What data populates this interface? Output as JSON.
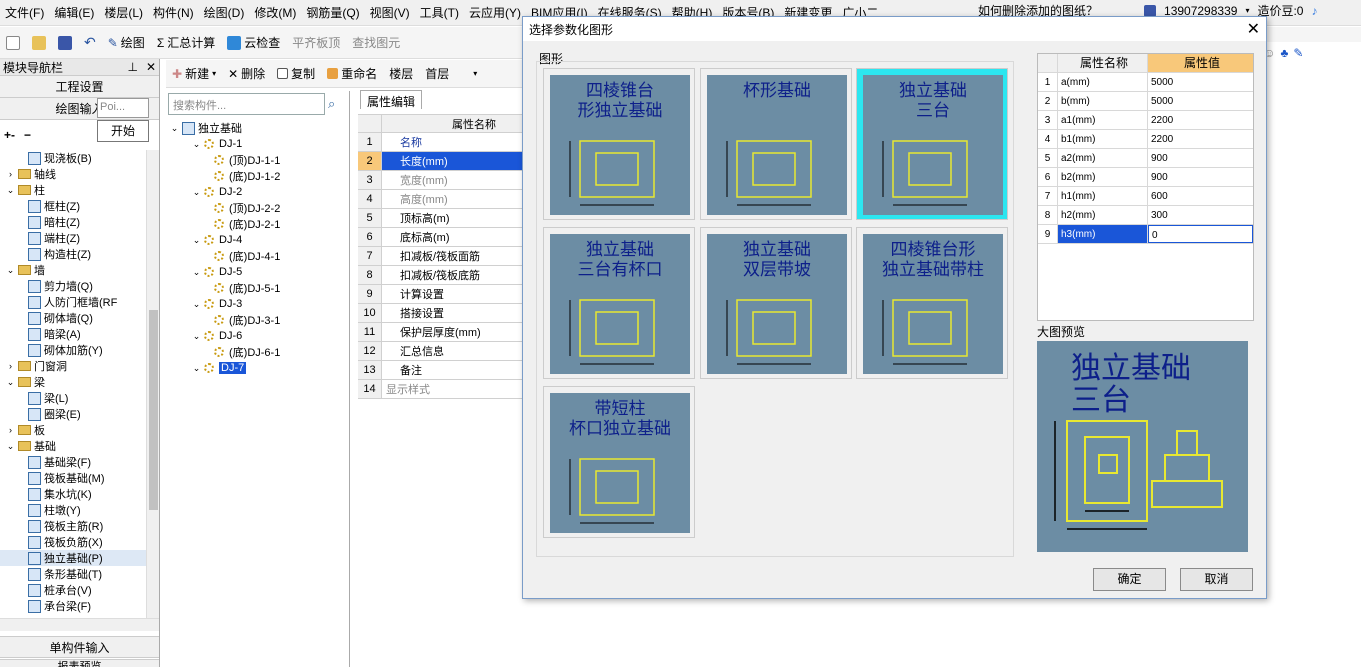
{
  "menu": [
    "文件(F)",
    "编辑(E)",
    "楼层(L)",
    "构件(N)",
    "绘图(D)",
    "修改(M)",
    "钢筋量(Q)",
    "视图(V)",
    "工具(T)",
    "云应用(Y)",
    "BIM应用(I)",
    "在线服务(S)",
    "帮助(H)",
    "版本号(B)",
    "新建变更",
    "广小二"
  ],
  "topright": {
    "help_text": "如何删除添加的图纸？",
    "phone": "13907298339",
    "coins": "造价豆:0"
  },
  "toolbar": {
    "draw": "绘图",
    "sum": "汇总计算",
    "cloud": "云检查",
    "flat": "平齐板顶",
    "find": "查找图元"
  },
  "subtoolbar": {
    "new": "新建",
    "delete": "删除",
    "copy": "复制",
    "rename": "重命名",
    "floor_label": "楼层",
    "floor_value": "首层"
  },
  "leftpanel": {
    "title": "模块导航栏",
    "project_btn": "工程设置",
    "draw_btn": "绘图输入",
    "popup_text": "Poi...",
    "start_btn": "开始",
    "items": [
      {
        "label": "现浇板(B)",
        "level": 2,
        "type": "leaf"
      },
      {
        "label": "轴线",
        "level": 1,
        "type": "folder",
        "fold": "+"
      },
      {
        "label": "柱",
        "level": 1,
        "type": "folder",
        "fold": "-"
      },
      {
        "label": "框柱(Z)",
        "level": 2,
        "type": "leaf"
      },
      {
        "label": "暗柱(Z)",
        "level": 2,
        "type": "leaf"
      },
      {
        "label": "端柱(Z)",
        "level": 2,
        "type": "leaf"
      },
      {
        "label": "构造柱(Z)",
        "level": 2,
        "type": "leaf"
      },
      {
        "label": "墙",
        "level": 1,
        "type": "folder",
        "fold": "-"
      },
      {
        "label": "剪力墙(Q)",
        "level": 2,
        "type": "leaf"
      },
      {
        "label": "人防门框墙(RF",
        "level": 2,
        "type": "leaf"
      },
      {
        "label": "砌体墙(Q)",
        "level": 2,
        "type": "leaf"
      },
      {
        "label": "暗梁(A)",
        "level": 2,
        "type": "leaf"
      },
      {
        "label": "砌体加筋(Y)",
        "level": 2,
        "type": "leaf"
      },
      {
        "label": "门窗洞",
        "level": 1,
        "type": "folder",
        "fold": "+"
      },
      {
        "label": "梁",
        "level": 1,
        "type": "folder",
        "fold": "-"
      },
      {
        "label": "梁(L)",
        "level": 2,
        "type": "leaf"
      },
      {
        "label": "圈梁(E)",
        "level": 2,
        "type": "leaf"
      },
      {
        "label": "板",
        "level": 1,
        "type": "folder",
        "fold": "+"
      },
      {
        "label": "基础",
        "level": 1,
        "type": "folder",
        "fold": "-"
      },
      {
        "label": "基础梁(F)",
        "level": 2,
        "type": "leaf"
      },
      {
        "label": "筏板基础(M)",
        "level": 2,
        "type": "leaf"
      },
      {
        "label": "集水坑(K)",
        "level": 2,
        "type": "leaf"
      },
      {
        "label": "柱墩(Y)",
        "level": 2,
        "type": "leaf"
      },
      {
        "label": "筏板主筋(R)",
        "level": 2,
        "type": "leaf"
      },
      {
        "label": "筏板负筋(X)",
        "level": 2,
        "type": "leaf"
      },
      {
        "label": "独立基础(P)",
        "level": 2,
        "type": "leaf",
        "selected": true
      },
      {
        "label": "条形基础(T)",
        "level": 2,
        "type": "leaf"
      },
      {
        "label": "桩承台(V)",
        "level": 2,
        "type": "leaf"
      },
      {
        "label": "承台梁(F)",
        "level": 2,
        "type": "leaf"
      }
    ],
    "bottom_btn": "单构件输入",
    "bottom_btn2": "报表预览"
  },
  "search": {
    "placeholder": "搜索构件..."
  },
  "tree": [
    {
      "label": "独立基础",
      "level": 0
    },
    {
      "label": "DJ-1",
      "level": 1
    },
    {
      "label": "(顶)DJ-1-1",
      "level": 2
    },
    {
      "label": "(底)DJ-1-2",
      "level": 2
    },
    {
      "label": "DJ-2",
      "level": 1
    },
    {
      "label": "(顶)DJ-2-2",
      "level": 2
    },
    {
      "label": "(底)DJ-2-1",
      "level": 2
    },
    {
      "label": "DJ-4",
      "level": 1
    },
    {
      "label": "(底)DJ-4-1",
      "level": 2
    },
    {
      "label": "DJ-5",
      "level": 1
    },
    {
      "label": "(底)DJ-5-1",
      "level": 2
    },
    {
      "label": "DJ-3",
      "level": 1
    },
    {
      "label": "(底)DJ-3-1",
      "level": 2
    },
    {
      "label": "DJ-6",
      "level": 1
    },
    {
      "label": "(底)DJ-6-1",
      "level": 2
    },
    {
      "label": "DJ-7",
      "level": 1,
      "selected": true
    }
  ],
  "props": {
    "tab": "属性编辑",
    "header": "属性名称",
    "rows": [
      {
        "n": "1",
        "t": "名称"
      },
      {
        "n": "2",
        "t": "长度(mm)"
      },
      {
        "n": "3",
        "t": "宽度(mm)"
      },
      {
        "n": "4",
        "t": "高度(mm)"
      },
      {
        "n": "5",
        "t": "顶标高(m)"
      },
      {
        "n": "6",
        "t": "底标高(m)"
      },
      {
        "n": "7",
        "t": "扣减板/筏板面筋"
      },
      {
        "n": "8",
        "t": "扣减板/筏板底筋"
      },
      {
        "n": "9",
        "t": "计算设置"
      },
      {
        "n": "10",
        "t": "搭接设置"
      },
      {
        "n": "11",
        "t": "保护层厚度(mm)"
      },
      {
        "n": "12",
        "t": "汇总信息"
      },
      {
        "n": "13",
        "t": "备注"
      },
      {
        "n": "14",
        "t": "显示样式"
      }
    ]
  },
  "dialog": {
    "title": "选择参数化图形",
    "group_label": "图形",
    "tiles": [
      {
        "caption": "四棱锥台\n形独立基础"
      },
      {
        "caption": "杯形基础"
      },
      {
        "caption": "独立基础\n三台",
        "selected": true
      },
      {
        "caption": "独立基础\n三台有杯口"
      },
      {
        "caption": "独立基础\n双层带坡"
      },
      {
        "caption": "四棱锥台形\n独立基础带柱"
      },
      {
        "caption": "带短柱\n杯口独立基础"
      }
    ],
    "grid_header": {
      "name": "属性名称",
      "value": "属性值"
    },
    "grid_rows": [
      {
        "n": "1",
        "name": "a(mm)",
        "value": "5000"
      },
      {
        "n": "2",
        "name": "b(mm)",
        "value": "5000"
      },
      {
        "n": "3",
        "name": "a1(mm)",
        "value": "2200"
      },
      {
        "n": "4",
        "name": "b1(mm)",
        "value": "2200"
      },
      {
        "n": "5",
        "name": "a2(mm)",
        "value": "900"
      },
      {
        "n": "6",
        "name": "b2(mm)",
        "value": "900"
      },
      {
        "n": "7",
        "name": "h1(mm)",
        "value": "600"
      },
      {
        "n": "8",
        "name": "h2(mm)",
        "value": "300"
      },
      {
        "n": "9",
        "name": "h3(mm)",
        "value": "0",
        "selected": true
      }
    ],
    "preview_label": "大图预览",
    "preview_caption": "独立基础\n三台",
    "ok": "确定",
    "cancel": "取消"
  }
}
